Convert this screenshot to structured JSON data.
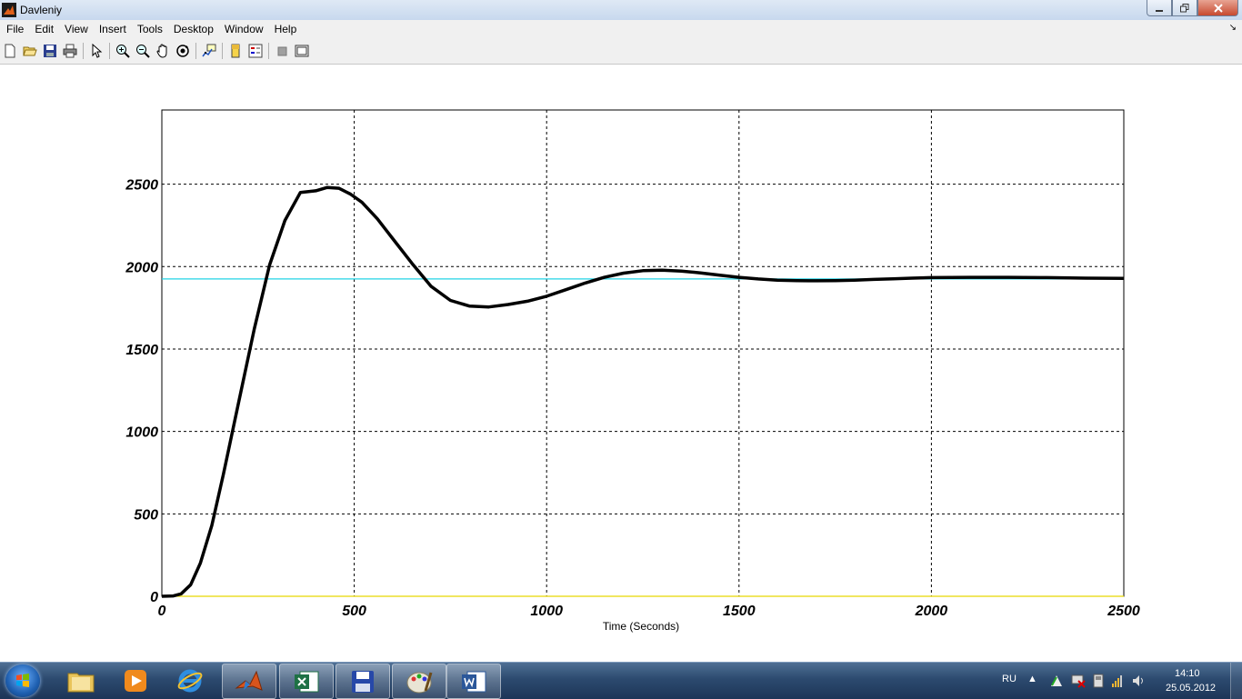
{
  "window": {
    "title": "Davleniy"
  },
  "menu": [
    "File",
    "Edit",
    "View",
    "Insert",
    "Tools",
    "Desktop",
    "Window",
    "Help"
  ],
  "toolbar": {
    "buttons": [
      "new-figure",
      "open-file",
      "save",
      "print",
      "select-arrow",
      "zoom-in",
      "zoom-out",
      "pan",
      "rotate-3d",
      "data-cursor",
      "insert-colorbar",
      "insert-legend",
      "hide-plot-tools",
      "show-plot-tools"
    ]
  },
  "chart_data": {
    "type": "line",
    "xlabel": "Time (Seconds)",
    "ylabel": "",
    "title": "",
    "xlim": [
      0,
      2500
    ],
    "ylim": [
      0,
      2950
    ],
    "xticks": [
      0,
      500,
      1000,
      1500,
      2000,
      2500
    ],
    "yticks": [
      0,
      500,
      1000,
      1500,
      2000,
      2500
    ],
    "grid": true,
    "series": [
      {
        "color": "#000000",
        "x": [
          0,
          30,
          50,
          75,
          100,
          130,
          160,
          200,
          240,
          280,
          320,
          360,
          400,
          430,
          460,
          490,
          520,
          560,
          600,
          650,
          700,
          750,
          800,
          850,
          900,
          950,
          1000,
          1050,
          1100,
          1150,
          1200,
          1250,
          1300,
          1350,
          1400,
          1450,
          1500,
          1550,
          1600,
          1650,
          1700,
          1750,
          1800,
          1850,
          1900,
          1950,
          2000,
          2100,
          2200,
          2300,
          2400,
          2500
        ],
        "y": [
          0,
          2,
          15,
          70,
          200,
          430,
          740,
          1180,
          1620,
          2010,
          2280,
          2450,
          2460,
          2480,
          2475,
          2440,
          2390,
          2290,
          2170,
          2020,
          1880,
          1795,
          1760,
          1755,
          1770,
          1790,
          1820,
          1860,
          1900,
          1935,
          1960,
          1975,
          1978,
          1973,
          1962,
          1948,
          1935,
          1925,
          1918,
          1915,
          1914,
          1915,
          1918,
          1922,
          1926,
          1930,
          1933,
          1935,
          1935,
          1933,
          1930,
          1928
        ]
      },
      {
        "color": "#22d3e6",
        "x": [
          0,
          2500
        ],
        "y": [
          1925,
          1925
        ]
      },
      {
        "color": "#e8d700",
        "x": [
          0,
          2500
        ],
        "y": [
          0,
          0
        ]
      }
    ]
  },
  "tray": {
    "language": "RU",
    "time": "14:10",
    "date": "25.05.2012"
  },
  "taskbar_apps": [
    "explorer",
    "media-player",
    "internet-explorer",
    "matlab",
    "excel",
    "save-disk",
    "paint",
    "word"
  ]
}
